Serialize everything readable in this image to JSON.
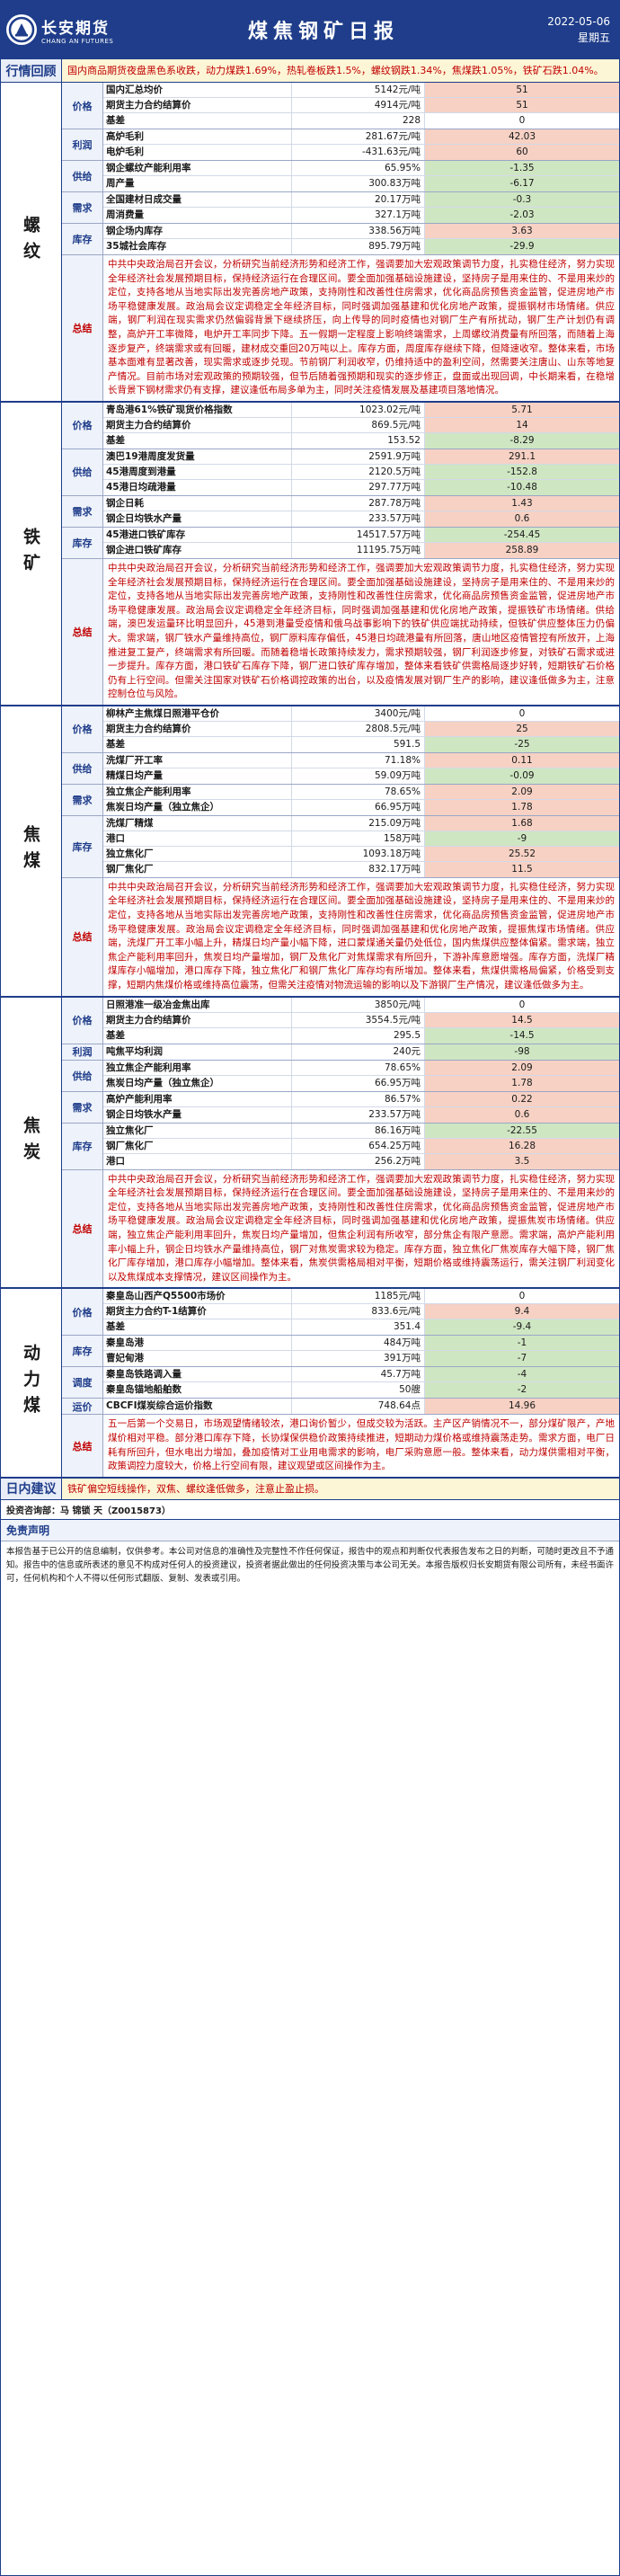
{
  "header": {
    "logo_cn": "长安期货",
    "logo_en": "CHANG AN FUTURES",
    "title": "煤焦钢矿日报",
    "date": "2022-05-06",
    "weekday": "星期五"
  },
  "review": {
    "label": "行情回顾",
    "text": "国内商品期货夜盘黑色系收跌，动力煤跌1.69%，热轧卷板跌1.5%，螺纹钢跌1.34%，焦煤跌1.05%，铁矿石跌1.04%。"
  },
  "colors": {
    "primary": "#1f3d8a",
    "up": "#f6d1c4",
    "down": "#cfe6c2",
    "text_red": "#c00000"
  },
  "sections": [
    {
      "name": "螺纹",
      "groups": [
        {
          "cat": "价格",
          "rows": [
            {
              "n": "国内汇总均价",
              "v": "5142元/吨",
              "c": "51",
              "t": "up"
            },
            {
              "n": "期货主力合约结算价",
              "v": "4914元/吨",
              "c": "51",
              "t": "up"
            },
            {
              "n": "基差",
              "v": "228",
              "c": "0",
              "t": "flat"
            }
          ]
        },
        {
          "cat": "利润",
          "rows": [
            {
              "n": "高炉毛利",
              "v": "281.67元/吨",
              "c": "42.03",
              "t": "up"
            },
            {
              "n": "电炉毛利",
              "v": "-431.63元/吨",
              "c": "60",
              "t": "up"
            }
          ]
        },
        {
          "cat": "供给",
          "rows": [
            {
              "n": "钢企螺纹产能利用率",
              "v": "65.95%",
              "c": "-1.35",
              "t": "down"
            },
            {
              "n": "周产量",
              "v": "300.83万吨",
              "c": "-6.17",
              "t": "down"
            }
          ]
        },
        {
          "cat": "需求",
          "rows": [
            {
              "n": "全国建材日成交量",
              "v": "20.17万吨",
              "c": "-0.3",
              "t": "down"
            },
            {
              "n": "周消费量",
              "v": "327.1万吨",
              "c": "-2.03",
              "t": "down"
            }
          ]
        },
        {
          "cat": "库存",
          "rows": [
            {
              "n": "钢企场内库存",
              "v": "338.56万吨",
              "c": "3.63",
              "t": "up"
            },
            {
              "n": "35城社会库存",
              "v": "895.79万吨",
              "c": "-29.9",
              "t": "down"
            }
          ]
        }
      ],
      "summary_label": "总结",
      "summary": "中共中央政治局召开会议，分析研究当前经济形势和经济工作，强调要加大宏观政策调节力度，扎实稳住经济，努力实现全年经济社会发展预期目标，保持经济运行在合理区间。要全面加强基础设施建设，坚持房子是用来住的、不是用来炒的定位，支持各地从当地实际出发完善房地产政策，支持刚性和改善性住房需求，优化商品房预售资金监管，促进房地产市场平稳健康发展。政治局会议定调稳定全年经济目标，同时强调加强基建和优化房地产政策，提振钢材市场情绪。供应端，钢厂利润在现实需求仍然偏弱背景下继续挤压，向上传导的同时疫情也对钢厂生产有所扰动，钢厂生产计划仍有调整，高炉开工率微降，电炉开工率同步下降。五一假期一定程度上影响终端需求，上周螺纹消费量有所回落，而随着上海逐步复产，终端需求或有回暖，建材成交重回20万吨以上。库存方面，周度库存继续下降，但降速收窄。整体来看，市场基本面难有显著改善，现实需求或逐步兑现。节前钢厂利润收窄，仍维持适中的盈利空间，然需要关注唐山、山东等地复产情况。目前市场对宏观政策的预期较强，但节后随着强预期和现实的逐步修正，盘面或出现回调，中长期来看，在稳增长背景下钢材需求仍有支撑，建议逢低布局多单为主，同时关注疫情发展及基建项目落地情况。"
    },
    {
      "name": "铁矿",
      "groups": [
        {
          "cat": "价格",
          "rows": [
            {
              "n": "青岛港61%铁矿现货价格指数",
              "v": "1023.02元/吨",
              "c": "5.71",
              "t": "up"
            },
            {
              "n": "期货主力合约结算价",
              "v": "869.5元/吨",
              "c": "14",
              "t": "up"
            },
            {
              "n": "基差",
              "v": "153.52",
              "c": "-8.29",
              "t": "down"
            }
          ]
        },
        {
          "cat": "供给",
          "rows": [
            {
              "n": "澳巴19港周度发货量",
              "v": "2591.9万吨",
              "c": "291.1",
              "t": "up"
            },
            {
              "n": "45港周度到港量",
              "v": "2120.5万吨",
              "c": "-152.8",
              "t": "down"
            },
            {
              "n": "45港日均疏港量",
              "v": "297.77万吨",
              "c": "-10.48",
              "t": "down"
            }
          ]
        },
        {
          "cat": "需求",
          "rows": [
            {
              "n": "钢企日耗",
              "v": "287.78万吨",
              "c": "1.43",
              "t": "up"
            },
            {
              "n": "钢企日均铁水产量",
              "v": "233.57万吨",
              "c": "0.6",
              "t": "up"
            }
          ]
        },
        {
          "cat": "库存",
          "rows": [
            {
              "n": "45港进口铁矿库存",
              "v": "14517.57万吨",
              "c": "-254.45",
              "t": "down"
            },
            {
              "n": "钢企进口铁矿库存",
              "v": "11195.75万吨",
              "c": "258.89",
              "t": "up"
            }
          ]
        }
      ],
      "summary_label": "总结",
      "summary": "中共中央政治局召开会议，分析研究当前经济形势和经济工作，强调要加大宏观政策调节力度，扎实稳住经济，努力实现全年经济社会发展预期目标，保持经济运行在合理区间。要全面加强基础设施建设，坚持房子是用来住的、不是用来炒的定位，支持各地从当地实际出发完善房地产政策，支持刚性和改善性住房需求，优化商品房预售资金监管，促进房地产市场平稳健康发展。政治局会议定调稳定全年经济目标，同时强调加强基建和优化房地产政策，提振铁矿市场情绪。供给端，澳巴发运量环比明显回升，45港到港量受疫情和俄乌战事影响下的铁矿供应端扰动持续，但铁矿供应整体压力仍偏大。需求端，钢厂铁水产量维持高位，钢厂原料库存偏低，45港日均疏港量有所回落，唐山地区疫情管控有所放开，上海推进复工复产，终端需求有所回暖。而随着稳增长政策持续发力，需求预期较强，钢厂利润逐步修复，对铁矿石需求或进一步提升。库存方面，港口铁矿石库存下降，钢厂进口铁矿库存增加，整体来看铁矿供需格局逐步好转，短期铁矿石价格仍有上行空间。但需关注国家对铁矿石价格调控政策的出台，以及疫情发展对钢厂生产的影响，建议逢低做多为主，注意控制仓位与风险。"
    },
    {
      "name": "焦煤",
      "groups": [
        {
          "cat": "价格",
          "rows": [
            {
              "n": "柳林产主焦煤日照港平仓价",
              "v": "3400元/吨",
              "c": "0",
              "t": "flat"
            },
            {
              "n": "期货主力合约结算价",
              "v": "2808.5元/吨",
              "c": "25",
              "t": "up"
            },
            {
              "n": "基差",
              "v": "591.5",
              "c": "-25",
              "t": "down"
            }
          ]
        },
        {
          "cat": "供给",
          "rows": [
            {
              "n": "洗煤厂开工率",
              "v": "71.18%",
              "c": "0.11",
              "t": "up"
            },
            {
              "n": "精煤日均产量",
              "v": "59.09万吨",
              "c": "-0.09",
              "t": "down"
            }
          ]
        },
        {
          "cat": "需求",
          "rows": [
            {
              "n": "独立焦企产能利用率",
              "v": "78.65%",
              "c": "2.09",
              "t": "up"
            },
            {
              "n": "焦炭日均产量（独立焦企）",
              "v": "66.95万吨",
              "c": "1.78",
              "t": "up"
            }
          ]
        },
        {
          "cat": "库存",
          "rows": [
            {
              "n": "洗煤厂精煤",
              "v": "215.09万吨",
              "c": "1.68",
              "t": "up"
            },
            {
              "n": "港口",
              "v": "158万吨",
              "c": "-9",
              "t": "down"
            },
            {
              "n": "独立焦化厂",
              "v": "1093.18万吨",
              "c": "25.52",
              "t": "up"
            },
            {
              "n": "钢厂焦化厂",
              "v": "832.17万吨",
              "c": "11.5",
              "t": "up"
            }
          ]
        }
      ],
      "summary_label": "总结",
      "summary": "中共中央政治局召开会议，分析研究当前经济形势和经济工作，强调要加大宏观政策调节力度，扎实稳住经济，努力实现全年经济社会发展预期目标，保持经济运行在合理区间。要全面加强基础设施建设，坚持房子是用来住的、不是用来炒的定位，支持各地从当地实际出发完善房地产政策，支持刚性和改善性住房需求，优化商品房预售资金监管，促进房地产市场平稳健康发展。政治局会议定调稳定全年经济目标，同时强调加强基建和优化房地产政策，提振焦煤市场情绪。供应端，洗煤厂开工率小幅上升，精煤日均产量小幅下降，进口蒙煤通关量仍处低位，国内焦煤供应整体偏紧。需求端，独立焦企产能利用率回升，焦炭日均产量增加，钢厂及焦化厂对焦煤需求有所回升，下游补库意愿增强。库存方面，洗煤厂精煤库存小幅增加，港口库存下降，独立焦化厂和钢厂焦化厂库存均有所增加。整体来看，焦煤供需格局偏紧，价格受到支撑，短期内焦煤价格或维持高位震荡，但需关注疫情对物流运输的影响以及下游钢厂生产情况，建议逢低做多为主。"
    },
    {
      "name": "焦炭",
      "groups": [
        {
          "cat": "价格",
          "rows": [
            {
              "n": "日照港准一级冶金焦出库",
              "v": "3850元/吨",
              "c": "0",
              "t": "flat"
            },
            {
              "n": "期货主力合约结算价",
              "v": "3554.5元/吨",
              "c": "14.5",
              "t": "up"
            },
            {
              "n": "基差",
              "v": "295.5",
              "c": "-14.5",
              "t": "down"
            }
          ]
        },
        {
          "cat": "利润",
          "rows": [
            {
              "n": "吨焦平均利润",
              "v": "240元",
              "c": "-98",
              "t": "down"
            }
          ]
        },
        {
          "cat": "供给",
          "rows": [
            {
              "n": "独立焦企产能利用率",
              "v": "78.65%",
              "c": "2.09",
              "t": "up"
            },
            {
              "n": "焦炭日均产量（独立焦企）",
              "v": "66.95万吨",
              "c": "1.78",
              "t": "up"
            }
          ]
        },
        {
          "cat": "需求",
          "rows": [
            {
              "n": "高炉产能利用率",
              "v": "86.57%",
              "c": "0.22",
              "t": "up"
            },
            {
              "n": "钢企日均铁水产量",
              "v": "233.57万吨",
              "c": "0.6",
              "t": "up"
            }
          ]
        },
        {
          "cat": "库存",
          "rows": [
            {
              "n": "独立焦化厂",
              "v": "86.16万吨",
              "c": "-22.55",
              "t": "down"
            },
            {
              "n": "钢厂焦化厂",
              "v": "654.25万吨",
              "c": "16.28",
              "t": "up"
            },
            {
              "n": "港口",
              "v": "256.2万吨",
              "c": "3.5",
              "t": "up"
            }
          ]
        }
      ],
      "summary_label": "总结",
      "summary": "中共中央政治局召开会议，分析研究当前经济形势和经济工作，强调要加大宏观政策调节力度，扎实稳住经济，努力实现全年经济社会发展预期目标，保持经济运行在合理区间。要全面加强基础设施建设，坚持房子是用来住的、不是用来炒的定位，支持各地从当地实际出发完善房地产政策，支持刚性和改善性住房需求，优化商品房预售资金监管，促进房地产市场平稳健康发展。政治局会议定调稳定全年经济目标，同时强调加强基建和优化房地产政策，提振焦炭市场情绪。供应端，独立焦企产能利用率回升，焦炭日均产量增加，但焦企利润有所收窄，部分焦企有限产意愿。需求端，高炉产能利用率小幅上升，钢企日均铁水产量维持高位，钢厂对焦炭需求较为稳定。库存方面，独立焦化厂焦炭库存大幅下降，钢厂焦化厂库存增加，港口库存小幅增加。整体来看，焦炭供需格局相对平衡，短期价格或维持震荡运行，需关注钢厂利润变化以及焦煤成本支撑情况，建议区间操作为主。"
    },
    {
      "name": "动力煤",
      "groups": [
        {
          "cat": "价格",
          "rows": [
            {
              "n": "秦皇岛山西产Q5500市场价",
              "v": "1185元/吨",
              "c": "0",
              "t": "flat"
            },
            {
              "n": "期货主力合约T-1结算价",
              "v": "833.6元/吨",
              "c": "9.4",
              "t": "up"
            },
            {
              "n": "基差",
              "v": "351.4",
              "c": "-9.4",
              "t": "down"
            }
          ]
        },
        {
          "cat": "库存",
          "rows": [
            {
              "n": "秦皇岛港",
              "v": "484万吨",
              "c": "-1",
              "t": "down"
            },
            {
              "n": "曹妃甸港",
              "v": "391万吨",
              "c": "-7",
              "t": "down"
            }
          ]
        },
        {
          "cat": "调度",
          "rows": [
            {
              "n": "秦皇岛铁路调入量",
              "v": "45.7万吨",
              "c": "-4",
              "t": "down"
            },
            {
              "n": "秦皇岛锚地船舶数",
              "v": "50艘",
              "c": "-2",
              "t": "down"
            }
          ]
        },
        {
          "cat": "运价",
          "rows": [
            {
              "n": "CBCFI煤炭综合运价指数",
              "v": "748.64点",
              "c": "14.96",
              "t": "up"
            }
          ]
        }
      ],
      "summary_label": "总结",
      "summary": "五一后第一个交易日，市场观望情绪较浓，港口询价暂少，但成交较为活跃。主产区产销情况不一，部分煤矿限产，产地煤价相对平稳。部分港口库存下降，长协煤保供稳价政策持续推进，短期动力煤价格或维持震荡走势。需求方面，电厂日耗有所回升，但水电出力增加，叠加疫情对工业用电需求的影响，电厂采购意愿一般。整体来看，动力煤供需相对平衡，政策调控力度较大，价格上行空间有限，建议观望或区间操作为主。"
    }
  ],
  "advice": {
    "label": "日内建议",
    "text": "铁矿偏空短线操作，双焦、螺纹逢低做多，注意止盈止损。"
  },
  "analyst": "投资咨询部：马 锦锁 天（Z0015873）",
  "disclaimer": {
    "title": "免责声明",
    "text": "本报告基于已公开的信息编制，仅供参考。本公司对信息的准确性及完整性不作任何保证，报告中的观点和判断仅代表报告发布之日的判断，可随时更改且不予通知。报告中的信息或所表述的意见不构成对任何人的投资建议，投资者据此做出的任何投资决策与本公司无关。本报告版权归长安期货有限公司所有，未经书面许可，任何机构和个人不得以任何形式翻版、复制、发表或引用。"
  }
}
